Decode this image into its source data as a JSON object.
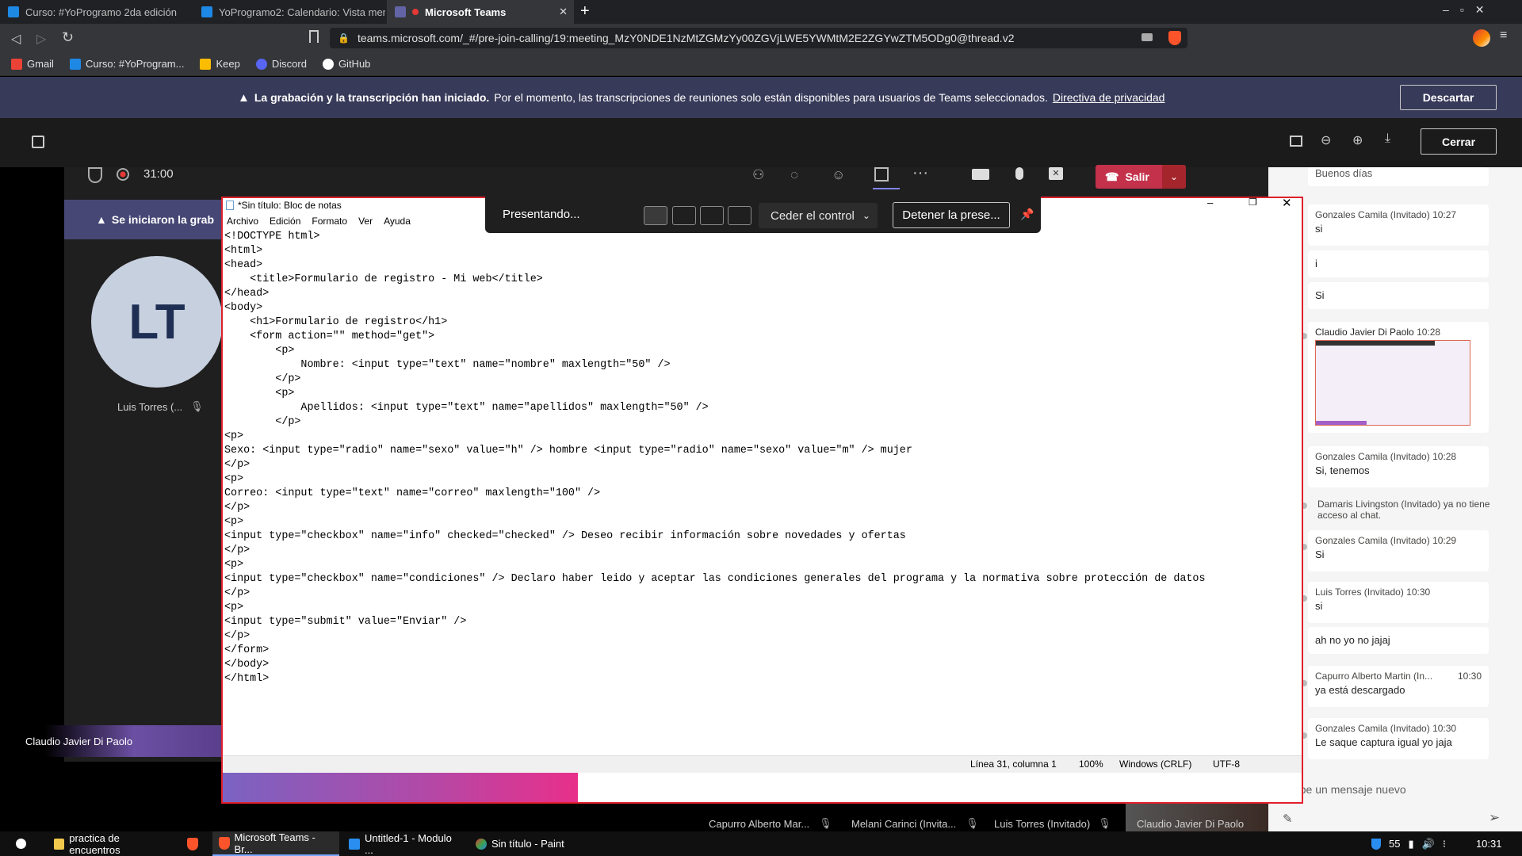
{
  "browser": {
    "tabs": [
      {
        "label": "Curso: #YoProgramo 2da edición",
        "color": "#1e88e5"
      },
      {
        "label": "YoProgramo2: Calendario: Vista mens",
        "color": "#1e88e5"
      },
      {
        "label": "Microsoft Teams",
        "color": "#6264a7",
        "active": true
      }
    ],
    "url": "teams.microsoft.com/_#/pre-join-calling/19:meeting_MzY0NDE1NzMtZGMzYy00ZGVjLWE5YWMtM2E2ZGYwZTM5ODg0@thread.v2",
    "bookmarks": [
      {
        "label": "Gmail",
        "color": "#ea4335"
      },
      {
        "label": "Curso: #YoProgram...",
        "color": "#1e88e5"
      },
      {
        "label": "Keep",
        "color": "#fbbc04"
      },
      {
        "label": "Discord",
        "color": "#5865f2"
      },
      {
        "label": "GitHub",
        "color": "#ffffff"
      }
    ]
  },
  "notice": {
    "bold": "La grabación y la transcripción han iniciado.",
    "text": "Por el momento, las transcripciones de reuniones solo están disponibles para usuarios de Teams seleccionados.",
    "link": "Directiva de privacidad",
    "dismiss": "Descartar"
  },
  "viewer": {
    "close": "Cerrar"
  },
  "meeting": {
    "timer": "31:00",
    "leave": "Salir",
    "banner": "Se iniciaron la grab",
    "avatar_initials": "LT",
    "participant_name": "Luis Torres (...",
    "presenter_name": "Claudio Javier Di Paolo",
    "participants": [
      "Capurro Alberto Mar...",
      "Melani Carinci (Invita...",
      "Luis Torres (Invitado)",
      "Claudio Javier Di Paolo"
    ]
  },
  "presenting": {
    "label": "Presentando...",
    "give_control": "Ceder el control",
    "stop": "Detener la prese..."
  },
  "notepad": {
    "title": "*Sin título: Bloc de notas",
    "menu": [
      "Archivo",
      "Edición",
      "Formato",
      "Ver",
      "Ayuda"
    ],
    "content": "<!DOCTYPE html>\n<html>\n<head>\n    <title>Formulario de registro - Mi web</title>\n</head>\n<body>\n    <h1>Formulario de registro</h1>\n    <form action=\"\" method=\"get\">\n        <p>\n            Nombre: <input type=\"text\" name=\"nombre\" maxlength=\"50\" />\n        </p>\n        <p>\n            Apellidos: <input type=\"text\" name=\"apellidos\" maxlength=\"50\" />\n        </p>\n<p>\nSexo: <input type=\"radio\" name=\"sexo\" value=\"h\" /> hombre <input type=\"radio\" name=\"sexo\" value=\"m\" /> mujer\n</p>\n<p>\nCorreo: <input type=\"text\" name=\"correo\" maxlength=\"100\" />\n</p>\n<p>\n<input type=\"checkbox\" name=\"info\" checked=\"checked\" /> Deseo recibir información sobre novedades y ofertas\n</p>\n<p>\n<input type=\"checkbox\" name=\"condiciones\" /> Declaro haber leido y aceptar las condiciones generales del programa y la normativa sobre protección de datos\n</p>\n<p>\n<input type=\"submit\" value=\"Enviar\" />\n</p>\n</form>\n</body>\n</html>",
    "status": {
      "position": "Línea 31, columna 1",
      "zoom": "100%",
      "eol": "Windows (CRLF)",
      "encoding": "UTF-8"
    }
  },
  "chat": {
    "top_partial": "Buenos días",
    "messages": [
      {
        "author": "Gonzales Camila (Invitado)",
        "time": "10:27",
        "text": "si"
      },
      {
        "author": "",
        "time": "",
        "text": "i"
      },
      {
        "author": "",
        "time": "",
        "text": "Si"
      },
      {
        "author": "Claudio Javier Di Paolo",
        "time": "10:28",
        "text": ""
      },
      {
        "author": "Gonzales Camila (Invitado)",
        "time": "10:28",
        "text": "Si, tenemos"
      },
      {
        "author": "Gonzales Camila (Invitado)",
        "time": "10:29",
        "text": "Si"
      },
      {
        "author": "Luis Torres (Invitado)",
        "time": "10:30",
        "text": "si"
      },
      {
        "author": "",
        "time": "",
        "text": "ah no yo no jajaj"
      },
      {
        "author": "Capurro Alberto Martin (In...",
        "time": "10:30",
        "text": "ya está descargado"
      },
      {
        "author": "Gonzales Camila (Invitado)",
        "time": "10:30",
        "text": "Le saque captura igual yo jaja"
      }
    ],
    "system": {
      "name": "Damaris Livingston (Invitado)",
      "text": "ya no tiene acceso al chat."
    },
    "input_placeholder": "scribe un mensaje nuevo"
  },
  "taskbar": {
    "items": [
      "practica de encuentros",
      "Microsoft Teams - Br...",
      "Untitled-1 - Modulo ...",
      "Sin título - Paint"
    ],
    "battery": "55",
    "clock": "10:31"
  }
}
